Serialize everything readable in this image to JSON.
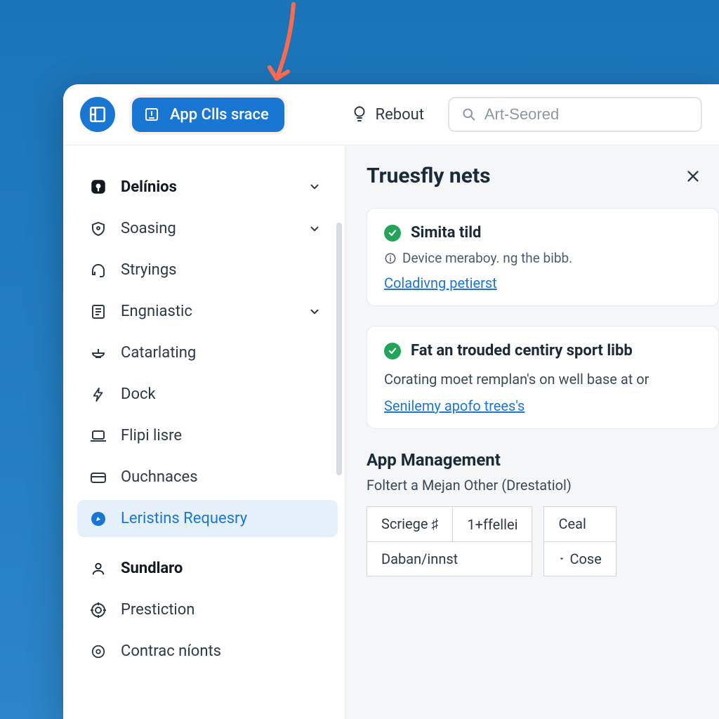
{
  "topbar": {
    "primary_label": "App Clls srace",
    "link_label": "Rebout",
    "search_placeholder": "Art-Seored"
  },
  "sidebar": {
    "items": [
      {
        "label": "Delínios",
        "bold": true,
        "chevron": true,
        "icon": "app"
      },
      {
        "label": "Soasing",
        "chevron": true,
        "icon": "shield"
      },
      {
        "label": "Stryings",
        "icon": "headset"
      },
      {
        "label": "Engniastic",
        "chevron": true,
        "icon": "list"
      },
      {
        "label": "Catarlating",
        "icon": "bowl"
      },
      {
        "label": "Dock",
        "icon": "bolt"
      },
      {
        "label": "Flipi lisre",
        "icon": "laptop"
      },
      {
        "label": "Ouchnaces",
        "icon": "card"
      },
      {
        "label": "Leristins Requesry",
        "active": true,
        "icon": "compass"
      },
      {
        "label": "Sundlaro",
        "bold": true,
        "icon": "person"
      },
      {
        "label": "Prestiction",
        "icon": "target"
      },
      {
        "label": "Contraс níonts",
        "icon": "doc"
      }
    ]
  },
  "main": {
    "title": "Truesfly nets",
    "cards": [
      {
        "title": "Simita tild",
        "subtext": "Device meraboy. ng the bibb.",
        "link": "Coladivng petierst"
      },
      {
        "title": "Fat an trouded centiry sport libb",
        "body": "Corating moet remplan's on well base at or",
        "link": "Senilemy apofo trees's"
      }
    ],
    "section": {
      "title": "App Management",
      "subtitle": "Foltert a Mejan Other (Drestatiol)",
      "table_left": [
        [
          "Scriege ♯",
          "1+ffellei"
        ],
        [
          "Daban/innst"
        ]
      ],
      "table_right": [
        [
          "Ceal"
        ],
        [
          "Cose"
        ]
      ]
    }
  }
}
